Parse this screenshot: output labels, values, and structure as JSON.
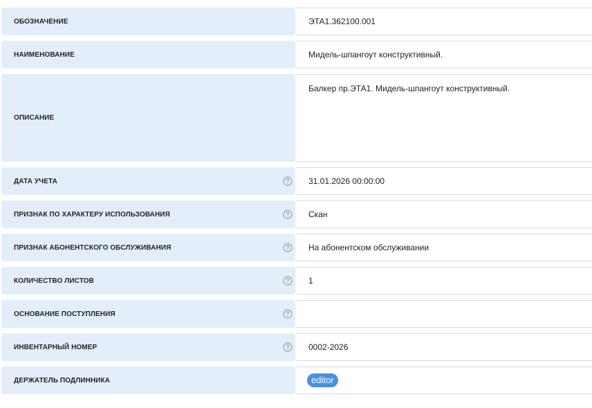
{
  "fields": [
    {
      "label": "ОБОЗНАЧЕНИЕ",
      "value": "ЭТА1.362100.001"
    },
    {
      "label": "НАИМЕНОВАНИЕ",
      "value": "Мидель-шпангоут конструктивный."
    },
    {
      "label": "ОПИСАНИЕ",
      "value": "Балкер пр.ЭТА1. Мидель-шпангоут конструктивный."
    },
    {
      "label": "ДАТА УЧЕТА",
      "value": "31.01.2026 00:00:00"
    },
    {
      "label": "ПРИЗНАК ПО ХАРАКТЕРУ ИСПОЛЬЗОВАНИЯ",
      "value": "Скан"
    },
    {
      "label": "ПРИЗНАК АБОНЕНТСКОГО ОБСЛУЖИВАНИЯ",
      "value": "На абонентском обслуживании"
    },
    {
      "label": "КОЛИЧЕСТВО ЛИСТОВ",
      "value": "1"
    },
    {
      "label": "ОСНОВАНИЕ ПОСТУПЛЕНИЯ",
      "value": ""
    },
    {
      "label": "ИНВЕНТАРНЫЙ НОМЕР",
      "value": "0002-2026"
    },
    {
      "label": "ДЕРЖАТЕЛЬ ПОДЛИННИКА",
      "value": "editor"
    }
  ],
  "icons": {
    "help": "help-circle-icon"
  },
  "colors": {
    "label_bg": "#e3eefb",
    "chip_bg": "#4a90e2",
    "help_icon": "#9e9e9e"
  }
}
